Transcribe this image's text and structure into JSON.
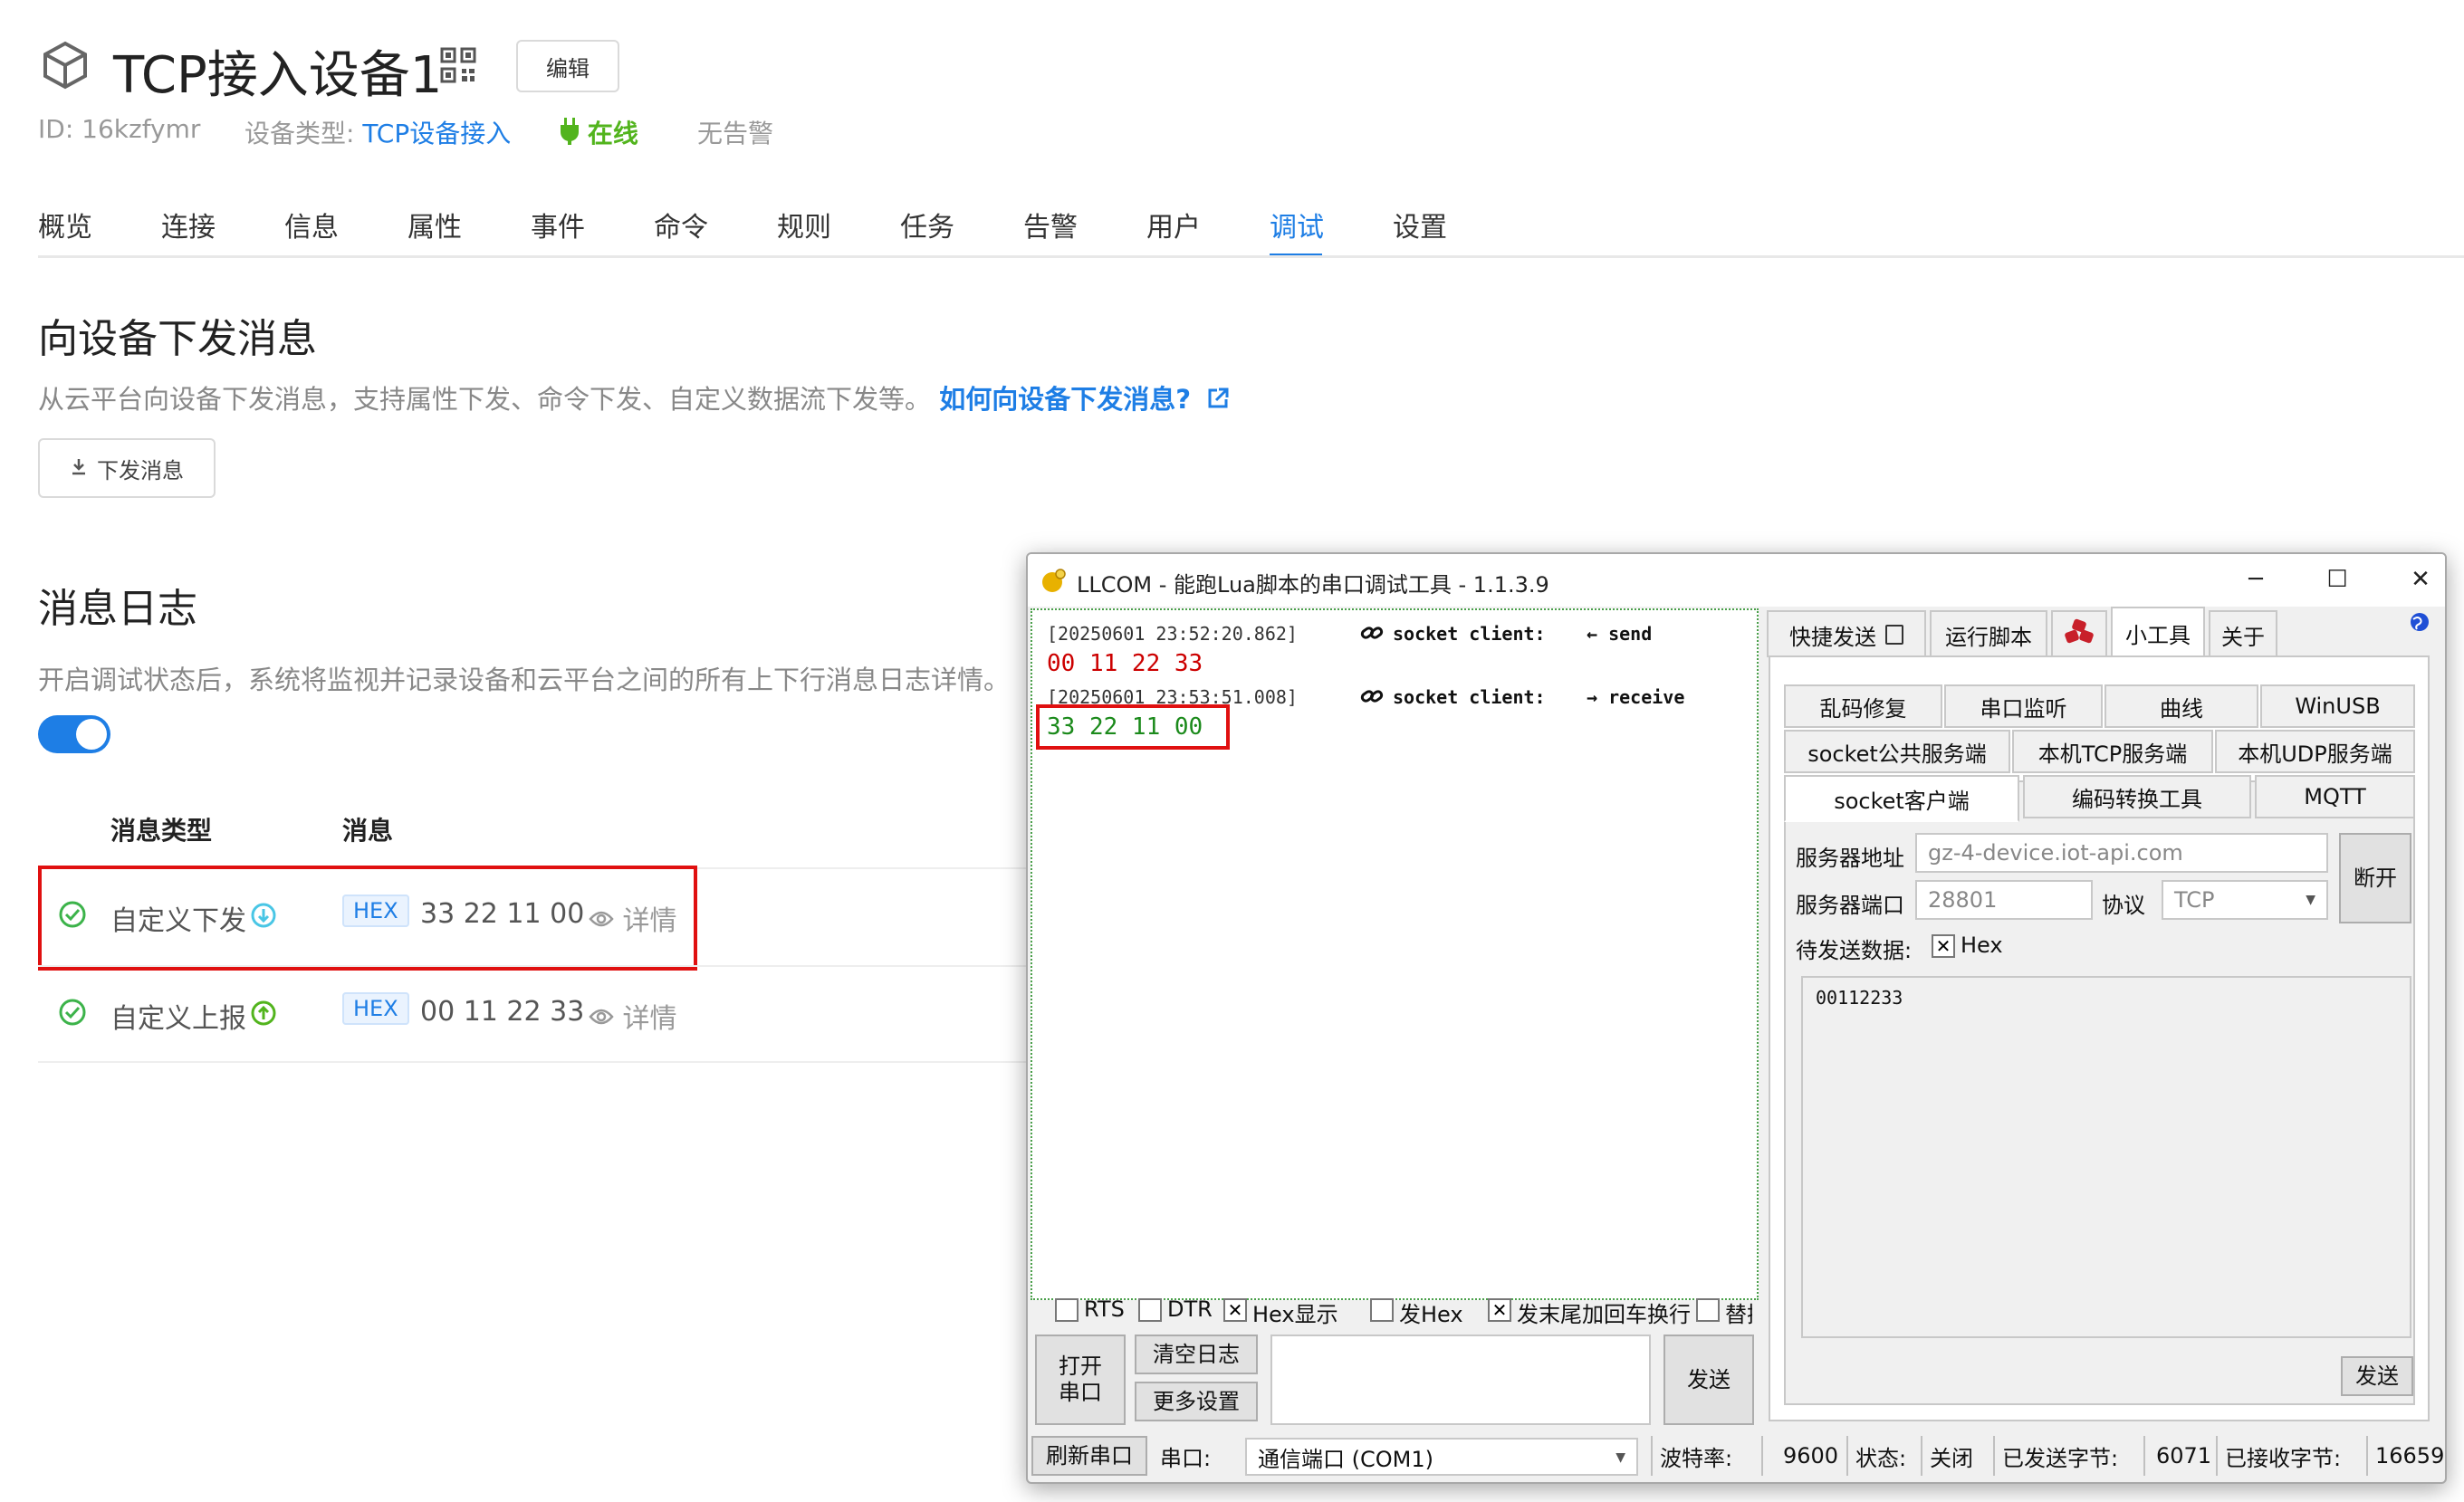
{
  "device": {
    "title": "TCP接入设备1",
    "edit_label": "编辑",
    "id_text": "ID: 16kzfymr",
    "type_label": "设备类型:",
    "type_value": "TCP设备接入",
    "status": "在线",
    "alarm": "无告警"
  },
  "tabs": [
    "概览",
    "连接",
    "信息",
    "属性",
    "事件",
    "命令",
    "规则",
    "任务",
    "告警",
    "用户",
    "调试",
    "设置"
  ],
  "active_tab": "调试",
  "send_section": {
    "title": "向设备下发消息",
    "desc": "从云平台向设备下发消息，支持属性下发、命令下发、自定义数据流下发等。",
    "help_link": "如何向设备下发消息?",
    "button": "下发消息"
  },
  "log_section": {
    "title": "消息日志",
    "desc": "开启调试状态后，系统将监视并记录设备和云平台之间的所有上下行消息日志详情。",
    "toggle_on": true,
    "columns": [
      "消息类型",
      "消息"
    ],
    "rows": [
      {
        "type": "自定义下发",
        "tag": "HEX",
        "message": "33 22 11 00",
        "detail": "详情"
      },
      {
        "type": "自定义上报",
        "tag": "HEX",
        "message": "00 11 22 33",
        "detail": "详情"
      }
    ]
  },
  "llcom": {
    "title": "LLCOM - 能跑Lua脚本的串口调试工具 - 1.1.3.9",
    "log": [
      {
        "time": "[20250601 23:52:20.862]",
        "source": "socket client:",
        "dir": "← send",
        "data": "00 11 22 33"
      },
      {
        "time": "[20250601 23:53:51.008]",
        "source": "socket client:",
        "dir": "→ receive",
        "data": "33 22 11 00"
      }
    ],
    "options": [
      {
        "label": "RTS",
        "checked": false
      },
      {
        "label": "DTR",
        "checked": false
      },
      {
        "label": "Hex显示",
        "checked": true
      },
      {
        "label": "发Hex",
        "checked": false
      },
      {
        "label": "发末尾加回车换行",
        "checked": true
      },
      {
        "label": "替换不",
        "checked": false
      }
    ],
    "open_port": "打开\n串口",
    "clear_log": "清空日志",
    "more_settings": "更多设置",
    "send": "发送",
    "top_tabs": [
      "快捷发送",
      "运行脚本",
      "",
      "小工具",
      "关于"
    ],
    "tool_tabs_row1": [
      "乱码修复",
      "串口监听",
      "曲线",
      "WinUSB"
    ],
    "tool_tabs_row2": [
      "socket公共服务端",
      "本机TCP服务端",
      "本机UDP服务端"
    ],
    "tool_tabs_row3": [
      "socket客户端",
      "编码转换工具",
      "MQTT"
    ],
    "server_addr_label": "服务器地址",
    "server_addr": "gz-4-device.iot-api.com",
    "server_port_label": "服务器端口",
    "server_port": "28801",
    "protocol_label": "协议",
    "protocol": "TCP",
    "disconnect": "断开",
    "pending_label": "待发送数据:",
    "hex_label": "Hex",
    "pending_data": "00112233",
    "panel_send": "发送",
    "status_bar": {
      "refresh": "刷新串口",
      "port_label": "串口:",
      "port_value": "通信端口 (COM1)",
      "baud_label": "波特率:",
      "baud_value": "9600",
      "state_label": "状态:",
      "state_value": "关闭",
      "sent_label": "已发送字节:",
      "sent_value": "6071",
      "recv_label": "已接收字节:",
      "recv_value": "16659"
    }
  },
  "colors": {
    "accent": "#1e7ee5",
    "online": "#52b41d",
    "highlight": "#e01010"
  }
}
